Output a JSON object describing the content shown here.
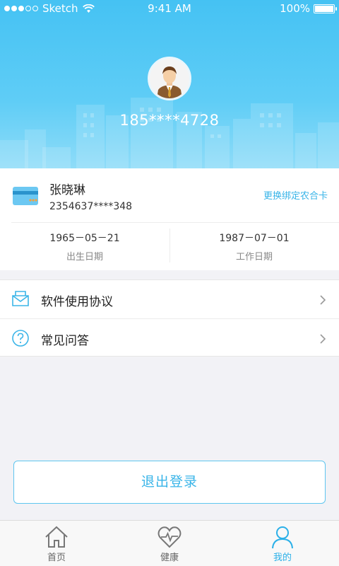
{
  "status_bar": {
    "carrier": "Sketch",
    "time": "9:41 AM",
    "battery": "100%"
  },
  "profile": {
    "phone": "185****4728"
  },
  "card": {
    "holder_name": "张晓琳",
    "card_number": "2354637****348",
    "rebind_label": "更换绑定农合卡",
    "birth_date": "1965－05－21",
    "birth_date_label": "出生日期",
    "work_date": "1987－07－01",
    "work_date_label": "工作日期"
  },
  "menu": {
    "items": [
      {
        "label": "软件使用协议",
        "icon": "envelope-icon"
      },
      {
        "label": "常见问答",
        "icon": "question-icon"
      }
    ]
  },
  "logout_label": "退出登录",
  "tabs": [
    {
      "label": "首页",
      "icon": "home-icon",
      "active": false
    },
    {
      "label": "健康",
      "icon": "heart-icon",
      "active": false
    },
    {
      "label": "我的",
      "icon": "user-icon",
      "active": true
    }
  ],
  "colors": {
    "header": "#45c2f3",
    "accent": "#38b4e8",
    "background": "#f2f2f6"
  }
}
